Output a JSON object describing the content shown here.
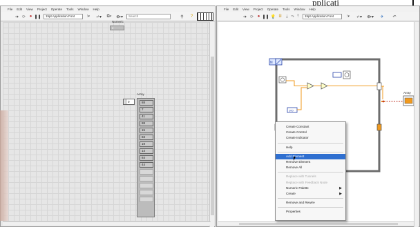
{
  "page_title_fragment": "pplicati",
  "front_panel": {
    "menu": [
      "File",
      "Edit",
      "View",
      "Project",
      "Operate",
      "Tools",
      "Window",
      "Help"
    ],
    "toolbar": {
      "font": "15pt Application Font",
      "search_placeholder": "Search",
      "icons": [
        "run-arrow-icon",
        "run-continuous-icon",
        "abort-icon",
        "pause-icon",
        "align-icon",
        "distribute-icon",
        "resize-icon",
        "reorder-icon",
        "search-icon",
        "help-icon",
        "connector-pane-icon"
      ]
    },
    "numeric": {
      "label": "Numeric",
      "value": "0"
    },
    "array": {
      "label": "Array",
      "index": "0",
      "values": [
        "88",
        "7",
        "41",
        "88",
        "15",
        "83",
        "19",
        "14",
        "84",
        "44"
      ],
      "empty_cells": 5
    }
  },
  "block_diagram": {
    "menu": [
      "File",
      "Edit",
      "View",
      "Project",
      "Operate",
      "Tools",
      "Window",
      "Help"
    ],
    "toolbar": {
      "font": "15pt Application Font",
      "icons": [
        "run-arrow-icon",
        "run-continuous-icon",
        "abort-icon",
        "pause-icon",
        "highlight-execution-icon",
        "retain-wire-values-icon",
        "step-into-icon",
        "step-over-icon",
        "step-out-icon",
        "align-icon",
        "distribute-icon",
        "reorder-icon",
        "clean-up-icon"
      ]
    },
    "loop_count": "N",
    "constant_value": "100",
    "indicator_label": "Array"
  },
  "context_menu": {
    "items": [
      {
        "label": "Create Constant",
        "disabled": false
      },
      {
        "label": "Create Control",
        "disabled": false
      },
      {
        "label": "Create Indicator",
        "disabled": false
      },
      {
        "sep": true
      },
      {
        "label": "Help",
        "disabled": false
      },
      {
        "sep": true
      },
      {
        "label": "Add Element",
        "disabled": false,
        "selected": true
      },
      {
        "label": "Remove Element",
        "disabled": false
      },
      {
        "label": "Remove All",
        "disabled": false
      },
      {
        "sep": true
      },
      {
        "label": "Replace with Tunnels",
        "disabled": true
      },
      {
        "label": "Replace with Feedback Node",
        "disabled": true
      },
      {
        "label": "Numeric Palette",
        "disabled": false,
        "submenu": true
      },
      {
        "label": "Create",
        "disabled": false,
        "submenu": true
      },
      {
        "sep": true
      },
      {
        "label": "Remove and Rewire",
        "disabled": false
      },
      {
        "sep": true
      },
      {
        "label": "Properties",
        "disabled": false
      }
    ]
  },
  "colors": {
    "selection": "#2f6fd0",
    "numeric_wire": "#f19a1e",
    "error_wire": "#c0392b",
    "loop_border": "#6d6d6d"
  }
}
